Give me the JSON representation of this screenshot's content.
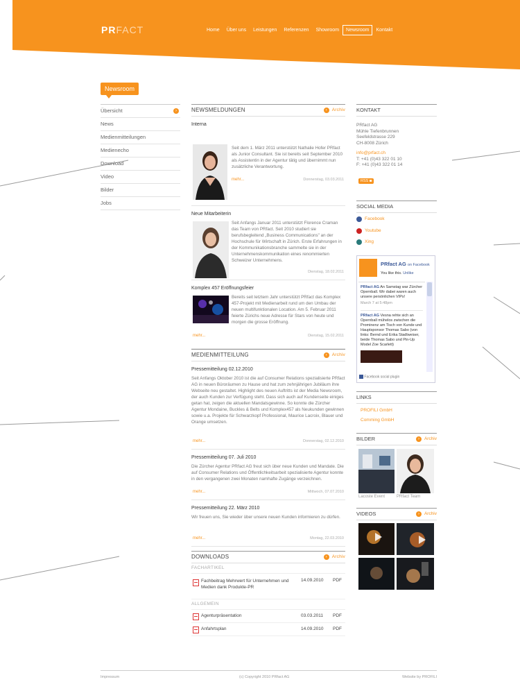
{
  "colors": {
    "brand": "#f7931e",
    "text": "#555555"
  },
  "header": {
    "logo_pr": "PR",
    "logo_fact": "FACT",
    "nav": [
      {
        "label": "Home",
        "active": false
      },
      {
        "label": "Über uns",
        "active": false
      },
      {
        "label": "Leistungen",
        "active": false
      },
      {
        "label": "Referenzen",
        "active": false
      },
      {
        "label": "Showroom",
        "active": false
      },
      {
        "label": "Newsroom",
        "active": true
      },
      {
        "label": "Kontakt",
        "active": false
      }
    ]
  },
  "newsroom_tag": "Newsroom",
  "left_menu": [
    "Übersicht",
    "News",
    "Medienmitteilungen",
    "Medienecho",
    "Download",
    "Video",
    "Bilder",
    "Jobs"
  ],
  "archive_label": "Archiv",
  "newsmeldungen": {
    "heading": "NEWSMELDUNGEN",
    "items": [
      {
        "title": "Interna",
        "text": "Seit dem 1. März 2011 unterstützt Nathalie Hofer PRfact als Junior Consultant. Sie ist bereits seit September 2010 als Assistentin in der Agentur tätig und übernimmt nun zusätzliche Verantwortung.",
        "more": "mehr...",
        "date": "Donnerstag, 03.03.2011"
      },
      {
        "title": "Neue Mitarbeiterin",
        "text": "Seit Anfangs Januar 2011 unterstützt Florence Craman das Team von PRfact. Seit 2010 studiert sie berufsbegleitend „Business Communications\" an der Hochschule für Wirtschaft in Zürich. Erste Erfahrungen in der Kommunikationsbranche sammelte sie in der Unternehmenskommunikation eines renommierten Schweizer Unternehmens.",
        "more": "",
        "date": "Dienstag, 18.02.2011"
      },
      {
        "title": "Komplex 457 Eröffnungsfeier",
        "text": "Bereits seit letztem Jahr unterstützt PRfact das Komplex 457-Projekt mit Medienarbeit rund um den Umbau der neuen multifunktionalen Location. Am 5. Februar 2011 feierte Zürichs neue Adresse für Stars von heute und morgen die grosse Eröffnung.",
        "more": "mehr...",
        "date": "Dienstag, 15.02.2011"
      }
    ]
  },
  "medienmitteilung": {
    "heading": "MEDIENMITTEILUNG",
    "items": [
      {
        "title": "Pressemitteilung 02.12.2010",
        "text": "Seit Anfangs Oktober 2010 ist die auf Consumer Relations spezialisierte PRfact AG in neuen Büroräumen zu Hause und hat zum zehnjährigen Jubiläum ihre Webseite neu gestaltet. Highlight des neuen Auftritts ist der Media Newsroom, der auch Kunden zur Verfügung steht. Dass sich auch auf Kundenseite einiges getan hat, zeigen die aktuellen Mandatsgewinne. So konnte die Zürcher Agentur Mondaine, Buckles & Belts und Komplex457 als Neukunden gewinnen sowie u.a. Projekte für Schwarzkopf Professional, Maurice Lacroix, Blauer und Orange umsetzen.",
        "more": "mehr...",
        "date": "Donnerstag, 02.12.2010"
      },
      {
        "title": "Pressemitteilung 07. Juli 2010",
        "text": "Die Zürcher Agentur PRfact AG freut sich über neue Kunden und Mandate. Die auf Consumer Relations und Öffentlichkeitsarbeit spezialisierte Agentur konnte in den vergangenen zwei Monaten namhafte Zugänge verzeichnen.",
        "more": "mehr...",
        "date": "Mittwoch, 07.07.2010"
      },
      {
        "title": "Pressemitteilung 22. März 2010",
        "text": "Wir freuen uns, Sie wieder über unsere neuen Kunden informieren zu dürfen.",
        "more": "mehr...",
        "date": "Montag, 22.03.2010"
      }
    ]
  },
  "downloads": {
    "heading": "DOWNLOADS",
    "groups": [
      {
        "name": "FACHARTIKEL",
        "rows": [
          {
            "title": "Fachbeitrag Mehrwert für Unternehmen und Medien dank Produkte-PR",
            "date": "14.09.2010",
            "type": "PDF"
          }
        ]
      },
      {
        "name": "ALLGEMEIN",
        "rows": [
          {
            "title": "Agenturpräsentation",
            "date": "03.03.2011",
            "type": "PDF"
          },
          {
            "title": "Anfahrtsplan",
            "date": "14.09.2010",
            "type": "PDF"
          }
        ]
      }
    ]
  },
  "kontakt": {
    "heading": "KONTAKT",
    "lines": [
      "PRfact AG",
      "Mühle Tiefenbrunnen",
      "Seefeldstrasse 229",
      "CH-8008 Zürich"
    ],
    "email": "info@prfact.ch",
    "phone": "T: +41 (0)43 322 01 10",
    "fax": "F: +41 (0)43 322 01 14",
    "rss": "RSS"
  },
  "social": {
    "heading": "SOCIAL MEDIA",
    "items": [
      {
        "label": "Facebook",
        "icon": "facebook-icon",
        "color": "#3b5998"
      },
      {
        "label": "Youtube",
        "icon": "youtube-icon",
        "color": "#cc2222"
      },
      {
        "label": "Xing",
        "icon": "xing-icon",
        "color": "#2a7a7a"
      }
    ]
  },
  "facebook": {
    "page": "PRfact AG",
    "on": "on Facebook",
    "like_text": "You like this.",
    "unlike": "Unlike",
    "post1_author": "PRfact AG",
    "post1_text": "An Samstag war Zürcher Opernball. Wir dabei waren auch unsere persönlichen VIPs!",
    "post1_time": "March 7 at 5:48pm",
    "post2_author": "PRfact AG",
    "post2_text": "Vesna rehte sich an Opernball mühelos zwischen die Prominenz am Tisch von Kunde und Hauptsponsor Thomas Sabo (von links: Bernd und Erika Stadlweiser, beide Thomas Sabo und Pin-Up Model Zoe Scarlett)",
    "plugin": "Facebook social plugin"
  },
  "links": {
    "heading": "LINKS",
    "items": [
      "PROFILI GmbH",
      "Comming GmbH"
    ]
  },
  "bilder": {
    "heading": "BILDER",
    "captions": [
      "Lacoste Event",
      "PRfact Team"
    ]
  },
  "videos": {
    "heading": "VIDEOS"
  },
  "footer": {
    "left": "Impressum",
    "center": "(c) Copyright 2010 PRfact AG",
    "right": "Website by PROFILI"
  }
}
